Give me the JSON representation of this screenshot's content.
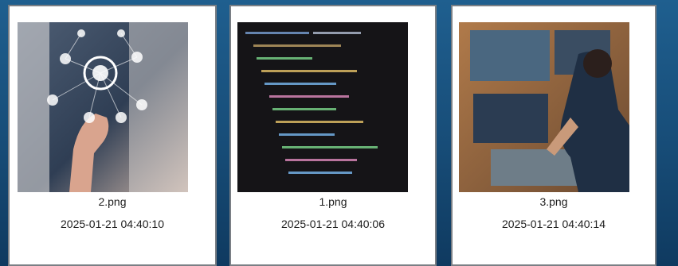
{
  "gallery": {
    "items": [
      {
        "file_name": "2.png",
        "timestamp": "2025-01-21 04:40:10"
      },
      {
        "file_name": "1.png",
        "timestamp": "2025-01-21 04:40:06"
      },
      {
        "file_name": "3.png",
        "timestamp": "2025-01-21 04:40:14"
      }
    ]
  }
}
